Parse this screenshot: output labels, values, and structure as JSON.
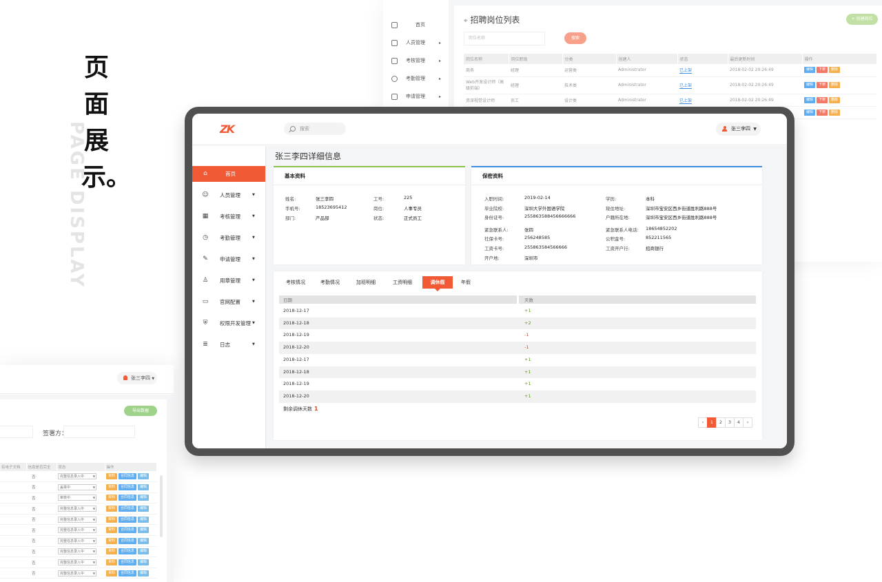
{
  "hero": {
    "title_chars": [
      "页",
      "面",
      "展",
      "示。"
    ],
    "english": "PAGE DISPLAY"
  },
  "back_top": {
    "sidebar": [
      "首页",
      "人员管理",
      "考核管理",
      "考勤管理",
      "申请管理"
    ],
    "title": "招聘岗位列表",
    "new_button": "+ 创建岗位",
    "search_placeholder": "岗位名称",
    "search_button": "搜索",
    "columns": [
      "岗位名称",
      "岗位职级",
      "分类",
      "创建人",
      "状态",
      "最后更新时间",
      "操作"
    ],
    "rows": [
      [
        "商务",
        "经理",
        "运营类",
        "Administrator",
        "已上架",
        "2018-02-02 20:26:49"
      ],
      [
        "Web开发设计师（高级前端）",
        "经理",
        "技术类",
        "Administrator",
        "已上架",
        "2018-02-02 20:26:49"
      ],
      [
        "资深视觉设计师",
        "员工",
        "设计类",
        "Administrator",
        "已上架",
        "2018-02-02 20:26:49"
      ],
      [
        "",
        "",
        "",
        "",
        "",
        ""
      ]
    ],
    "actions": [
      "编辑",
      "下架",
      "删除"
    ]
  },
  "back_bottom": {
    "user": "张三李四",
    "export_button": "导出数据",
    "signer_label": "签署方：",
    "columns": [
      "有电子文档",
      "信息是否完全",
      "状态",
      "操作"
    ],
    "rows": [
      {
        "complete": "否",
        "status": "完整信息录入中"
      },
      {
        "complete": "否",
        "status": "盖章中"
      },
      {
        "complete": "否",
        "status": "审核中"
      },
      {
        "complete": "否",
        "status": "完整信息录入中"
      },
      {
        "complete": "否",
        "status": "完整信息录入中"
      },
      {
        "complete": "否",
        "status": "完整信息录入中"
      },
      {
        "complete": "否",
        "status": "完整信息录入中"
      },
      {
        "complete": "否",
        "status": "完整信息录入中"
      },
      {
        "complete": "否",
        "status": "完整信息录入中"
      },
      {
        "complete": "否",
        "status": "完整信息录入中"
      }
    ],
    "actions": [
      "资料",
      "合同信息",
      "编辑"
    ]
  },
  "app": {
    "logo": "ZK",
    "search_placeholder": "搜索",
    "user": "张三李四",
    "nav": [
      {
        "label": "首页",
        "icon": "home-icon",
        "glyph": "⌂",
        "active": true
      },
      {
        "label": "人员管理",
        "icon": "people-icon",
        "glyph": "☺"
      },
      {
        "label": "考核管理",
        "icon": "calendar-icon",
        "glyph": "▦"
      },
      {
        "label": "考勤管理",
        "icon": "clock-icon",
        "glyph": "◷"
      },
      {
        "label": "申请管理",
        "icon": "edit-icon",
        "glyph": "✎"
      },
      {
        "label": "用章管理",
        "icon": "stamp-icon",
        "glyph": "♙"
      },
      {
        "label": "官网配置",
        "icon": "monitor-icon",
        "glyph": "▭"
      },
      {
        "label": "权限开发管理",
        "icon": "shield-icon",
        "glyph": "⛨"
      },
      {
        "label": "日志",
        "icon": "log-icon",
        "glyph": "≣"
      }
    ],
    "page_title": "张三李四详细信息",
    "basic": {
      "title": "基本资料",
      "fields": [
        {
          "k": "姓名:",
          "v": "张三李四"
        },
        {
          "k": "工号:",
          "v": "225"
        },
        {
          "k": "手机号:",
          "v": "18523695412"
        },
        {
          "k": "岗位:",
          "v": "人事专员"
        },
        {
          "k": "部门:",
          "v": "产品部"
        },
        {
          "k": "状态:",
          "v": "正式员工"
        }
      ]
    },
    "secret": {
      "title": "保密资料",
      "fields": [
        {
          "k": "入职时间:",
          "v": "2019-02-14"
        },
        {
          "k": "学历:",
          "v": "本科"
        },
        {
          "k": "毕业院校:",
          "v": "深圳大学外国语学院"
        },
        {
          "k": "现住地址:",
          "v": "深圳市宝安区西乡街道胜利路888号"
        },
        {
          "k": "身份证号:",
          "v": "255863588456666666"
        },
        {
          "k": "户籍所在地:",
          "v": "深圳市宝安区西乡街道胜利路888号"
        },
        {
          "k": "紧急联系人:",
          "v": "张四"
        },
        {
          "k": "紧急联系人电话:",
          "v": "18654852202"
        },
        {
          "k": "社保卡号:",
          "v": "256248585"
        },
        {
          "k": "公积金号:",
          "v": "852211565"
        },
        {
          "k": "工资卡号:",
          "v": "255863584566666"
        },
        {
          "k": "工资开户行:",
          "v": "招商银行"
        },
        {
          "k": "开户地:",
          "v": "深圳市"
        }
      ]
    },
    "tabs": [
      "考核情况",
      "考勤情况",
      "加班明细",
      "工资明细",
      "调休假",
      "年假"
    ],
    "active_tab": 4,
    "table": {
      "columns": [
        "日期",
        "天数"
      ],
      "rows": [
        {
          "date": "2018-12-17",
          "days": "+1"
        },
        {
          "date": "2018-12-18",
          "days": "+2"
        },
        {
          "date": "2018-12-19",
          "days": "-1"
        },
        {
          "date": "2018-12-20",
          "days": "-1"
        },
        {
          "date": "2018-12-17",
          "days": "+1"
        },
        {
          "date": "2018-12-18",
          "days": "+1"
        },
        {
          "date": "2018-12-19",
          "days": "+1"
        },
        {
          "date": "2018-12-20",
          "days": "+1"
        }
      ]
    },
    "remaining_label": "剩余调休天数",
    "remaining_value": "1",
    "pager": [
      "‹",
      "1",
      "2",
      "3",
      "4",
      "›"
    ],
    "current_page": "1"
  }
}
